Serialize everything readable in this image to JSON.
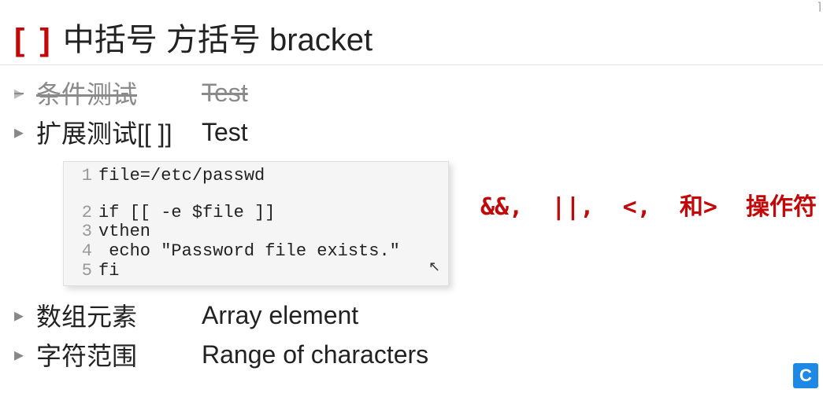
{
  "title": {
    "bracket": "[ ]",
    "text": "中括号 方括号 bracket"
  },
  "items": [
    {
      "cn": "条件测试",
      "en": "Test",
      "struck": true
    },
    {
      "cn": "扩展测试[[ ]]",
      "en": "Test",
      "struck": false
    }
  ],
  "code": {
    "lines": [
      {
        "n": "1",
        "t": "file=/etc/passwd"
      },
      {
        "n": "",
        "t": ""
      },
      {
        "n": "2",
        "t": "if [[ -e $file ]]"
      },
      {
        "n": "3",
        "t": "vthen"
      },
      {
        "n": "4",
        "t": " echo \"Password file exists.\""
      },
      {
        "n": "5",
        "t": "fi"
      }
    ]
  },
  "operators_note": "&&,  ||,  <,  和>  操作符",
  "items_after": [
    {
      "cn": "数组元素",
      "en": "Array element"
    },
    {
      "cn": "字符范围",
      "en": "Range of characters"
    }
  ],
  "logo": "C"
}
